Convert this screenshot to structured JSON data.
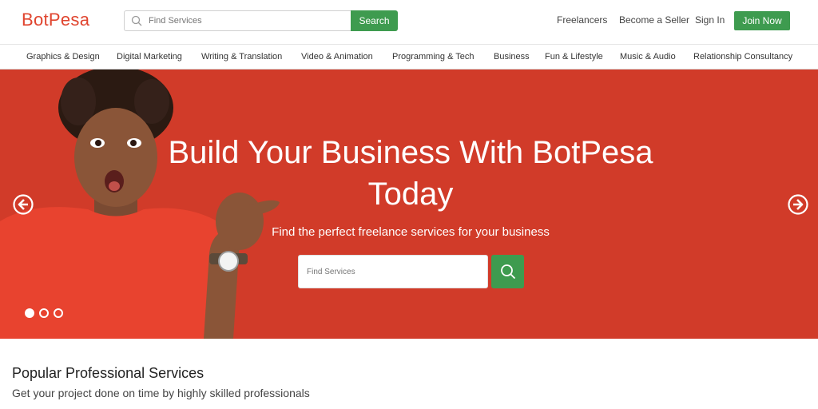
{
  "header": {
    "logo": "BotPesa",
    "search_placeholder": "Find Services",
    "search_button": "Search",
    "nav": [
      "Freelancers",
      "Become a Seller",
      "Sign In"
    ],
    "join_button": "Join Now"
  },
  "categories": [
    "Graphics & Design",
    "Digital Marketing",
    "Writing & Translation",
    "Video & Animation",
    "Programming & Tech",
    "Business",
    "Fun & Lifestyle",
    "Music & Audio",
    "Relationship Consultancy"
  ],
  "hero": {
    "title_line1": "Build Your Business With BotPesa",
    "title_line2": "Today",
    "subtitle": "Find the perfect freelance services for your business",
    "search_placeholder": "Find Services",
    "slides": 3,
    "active_slide": 1
  },
  "section": {
    "title": "Popular Professional Services",
    "subtitle": "Get your project done on time by highly skilled professionals"
  },
  "colors": {
    "brand": "#e0452f",
    "hero_bg": "#d13b29",
    "accent_green": "#3e9b4f"
  }
}
